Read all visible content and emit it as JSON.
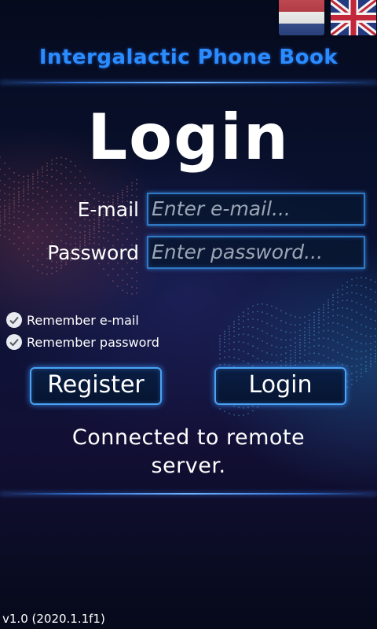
{
  "app_title": "Intergalactic Phone Book",
  "page_title": "Login",
  "languages": [
    {
      "name": "dutch-flag-icon"
    },
    {
      "name": "uk-flag-icon"
    }
  ],
  "form": {
    "email_label": "E-mail",
    "email_placeholder": "Enter e-mail...",
    "email_value": "",
    "password_label": "Password",
    "password_placeholder": "Enter password...",
    "password_value": ""
  },
  "options": {
    "remember_email_label": "Remember e-mail",
    "remember_email_checked": true,
    "remember_password_label": "Remember password",
    "remember_password_checked": true
  },
  "buttons": {
    "register_label": "Register",
    "login_label": "Login"
  },
  "status_text": "Connected to remote server.",
  "version_text": "v1.0 (2020.1.1f1)",
  "colors": {
    "title_blue": "#2a8cff",
    "glow_blue": "#4aa3f5",
    "background": "#0b1436"
  }
}
